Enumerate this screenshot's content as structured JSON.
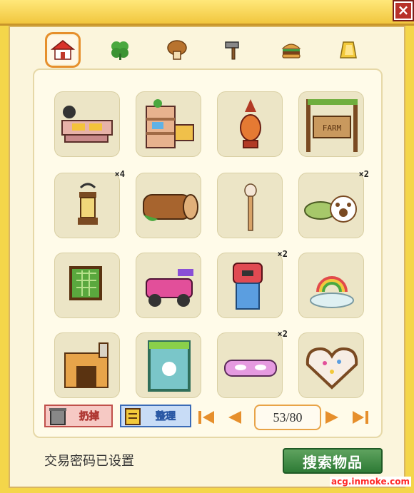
{
  "window": {
    "close_glyph": "×"
  },
  "tabs": [
    {
      "name": "house-icon",
      "active": true
    },
    {
      "name": "clover-icon",
      "active": false
    },
    {
      "name": "mushroom-icon",
      "active": false
    },
    {
      "name": "hammer-icon",
      "active": false
    },
    {
      "name": "burger-icon",
      "active": false
    },
    {
      "name": "gold-bar-icon",
      "active": false
    }
  ],
  "items": [
    {
      "name": "bench-item",
      "count": ""
    },
    {
      "name": "flower-shelf-item",
      "count": ""
    },
    {
      "name": "red-lantern-item",
      "count": ""
    },
    {
      "name": "farm-sign-item",
      "count": ""
    },
    {
      "name": "oil-lamp-item",
      "count": "×4"
    },
    {
      "name": "log-item",
      "count": ""
    },
    {
      "name": "bunny-post-item",
      "count": ""
    },
    {
      "name": "paw-cushion-item",
      "count": "×2"
    },
    {
      "name": "green-frame-item",
      "count": ""
    },
    {
      "name": "toy-car-item",
      "count": ""
    },
    {
      "name": "trash-bin-item",
      "count": "×2"
    },
    {
      "name": "rainbow-fountain-item",
      "count": ""
    },
    {
      "name": "fireplace-item",
      "count": ""
    },
    {
      "name": "painting-item",
      "count": ""
    },
    {
      "name": "pink-bench-item",
      "count": "×2"
    },
    {
      "name": "heart-cake-item",
      "count": ""
    }
  ],
  "toolbar": {
    "discard_label": "扔掉",
    "sort_label": "整理"
  },
  "pager": {
    "page_text": "53/80"
  },
  "status_text": "交易密码已设置",
  "search_label": "搜索物品",
  "watermark": "acg.inmoke.com",
  "colors": {
    "accent": "#e68f2c",
    "search_green": "#2d7a35",
    "frame_yellow": "#f4d64a"
  }
}
